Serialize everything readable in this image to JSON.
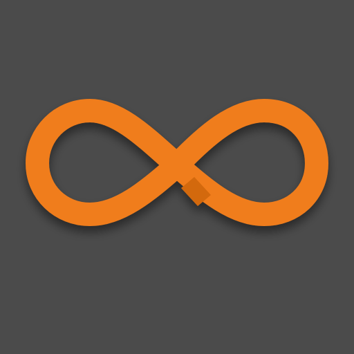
{
  "icon": {
    "name": "infinity-icon",
    "colors": {
      "background": "#4b4b4b",
      "stroke": "#f07d1b",
      "crossing_shade": "#d3690f",
      "shadow": "#000000"
    }
  }
}
